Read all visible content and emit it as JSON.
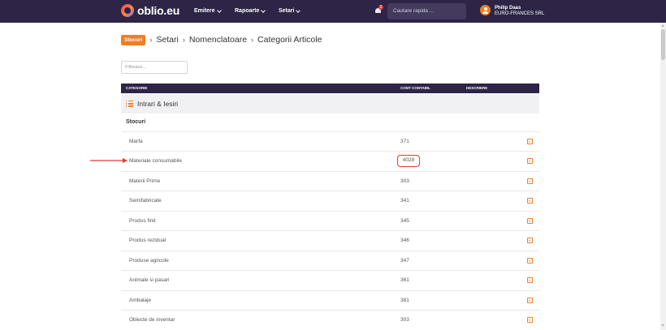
{
  "navbar": {
    "logo_text": "oblio.eu",
    "menu": [
      {
        "label": "Emitere"
      },
      {
        "label": "Rapoarte"
      },
      {
        "label": "Setari"
      }
    ],
    "notification_count": "2",
    "search_placeholder": "Cautare rapida ...",
    "user_name": "Philip Daas",
    "user_company": "EURO-FRANCES SRL"
  },
  "breadcrumb": {
    "badge": "Stocuri",
    "items": [
      "Setari",
      "Nomenclatoare",
      "Categorii Articole"
    ]
  },
  "filter": {
    "placeholder": "Filtreaza..."
  },
  "table": {
    "headers": {
      "category": "CATEGORIE",
      "account": "CONT CONTABIL",
      "description": "DESCRIERE"
    },
    "group": "Intrari & Iesiri",
    "subgroup": "Stocuri",
    "rows": [
      {
        "name": "Marfa",
        "account": "371"
      },
      {
        "name": "Materiale consumabile",
        "account": "4028"
      },
      {
        "name": "Materii Prime",
        "account": "303"
      },
      {
        "name": "Semifabricate",
        "account": "341"
      },
      {
        "name": "Produs finit",
        "account": "345"
      },
      {
        "name": "Produs rezidual",
        "account": "346"
      },
      {
        "name": "Produse agricole",
        "account": "347"
      },
      {
        "name": "Animale si pasari",
        "account": "361"
      },
      {
        "name": "Ambalaje",
        "account": "381"
      },
      {
        "name": "Obiecte de inventar",
        "account": "303"
      }
    ]
  },
  "colors": {
    "navbar": "#2d2446",
    "accent": "#f57c20",
    "highlight": "#e53935"
  }
}
